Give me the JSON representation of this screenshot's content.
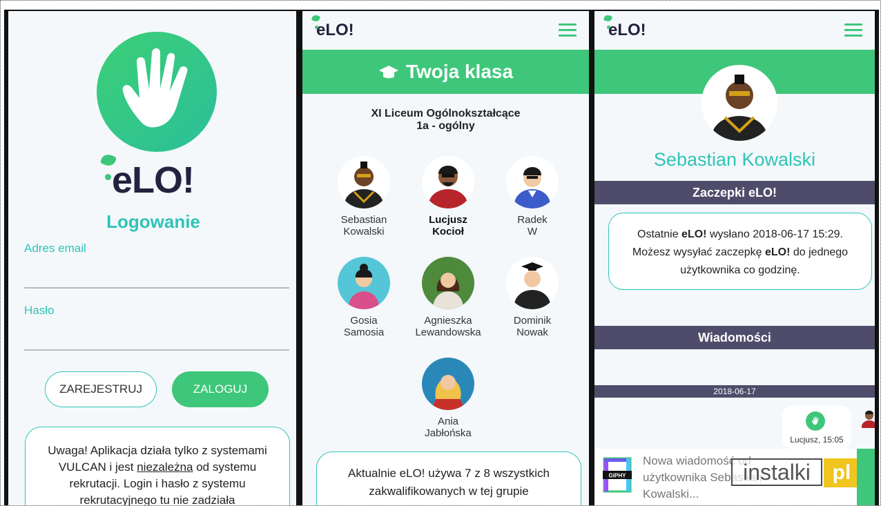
{
  "login": {
    "brand": "eLO!",
    "title": "Logowanie",
    "email_label": "Adres email",
    "password_label": "Hasło",
    "register_label": "ZAREJESTRUJ",
    "login_label": "ZALOGUJ",
    "notice_before": "Uwaga! Aplikacja działa tylko z systemami VULCAN i jest ",
    "notice_link": "niezależna",
    "notice_after": " od systemu rekrutacji. Login i hasło z systemu rekrutacyjnego tu nie zadziała"
  },
  "class": {
    "brand": "eLO!",
    "header": "Twoja klasa",
    "school_line1": "XI Liceum Ogólnokształcące",
    "school_line2": "1a - ogólny",
    "students": [
      {
        "first": "Sebastian",
        "last": "Kowalski"
      },
      {
        "first": "Lucjusz",
        "last": "Kocioł"
      },
      {
        "first": "Radek",
        "last": "W"
      },
      {
        "first": "Gosia",
        "last": "Samosia"
      },
      {
        "first": "Agnieszka",
        "last": "Lewandowska"
      },
      {
        "first": "Dominik",
        "last": "Nowak"
      },
      {
        "first": "Ania",
        "last": "Jabłońska"
      }
    ],
    "notice": "Aktualnie eLO! używa 7 z 8 wszystkich zakwalifikowanych w tej grupie"
  },
  "profile": {
    "brand": "eLO!",
    "name": "Sebastian Kowalski",
    "section_hooks": "Zaczepki eLO!",
    "notice_p1": "Ostatnie ",
    "notice_b1": "eLO!",
    "notice_p2": " wysłano 2018-06-17 15:29. Możesz wysyłać zaczepkę ",
    "notice_b2": "eLO!",
    "notice_p3": " do jednego użytkownika co godzinę.",
    "section_messages": "Wiadomości",
    "date": "2018-06-17",
    "message_meta": "Lucjusz, 15:05",
    "toast_line1": "Nowa wiadomość od",
    "toast_line2": "użytkownika Sebastian",
    "toast_line3": "Kowalski...",
    "giphy": "GIPHY",
    "watermark": "instalki",
    "watermark_pl": "pl"
  },
  "colors": {
    "accent_green": "#3ec77a",
    "accent_teal": "#2fc4b6",
    "section_bar": "#4f4c6b",
    "panel_bg": "#f4f8fb"
  },
  "icons": [
    "hand-icon",
    "menu-icon",
    "graduation-cap-icon",
    "avatar-icon",
    "giphy-icon"
  ]
}
